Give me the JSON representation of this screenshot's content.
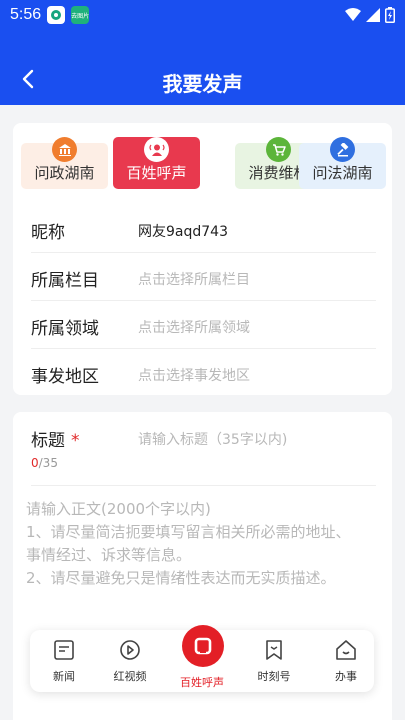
{
  "status_bar": {
    "time": "5:56",
    "app_badge": "去图片",
    "icons": [
      "wifi-icon",
      "signal-icon",
      "battery-icon"
    ]
  },
  "header": {
    "title": "我要发声",
    "back_icon": "chevron-left-icon",
    "background": "#1a4ff0"
  },
  "categories": [
    {
      "label": "问政湖南",
      "icon": "government-building-icon",
      "selected": false
    },
    {
      "label": "百姓呼声",
      "icon": "speaking-person-icon",
      "selected": true
    },
    {
      "label": "消费维权",
      "icon": "shopping-cart-icon",
      "selected": false
    },
    {
      "label": "问法湖南",
      "icon": "gavel-icon",
      "selected": false
    }
  ],
  "form": {
    "nickname": {
      "label": "昵称",
      "value": "网友9aqd743"
    },
    "column": {
      "label": "所属栏目",
      "placeholder": "点击选择所属栏目"
    },
    "field": {
      "label": "所属领域",
      "placeholder": "点击选择所属领域"
    },
    "region": {
      "label": "事发地区",
      "placeholder": "点击选择事发地区"
    }
  },
  "post": {
    "title_label": "标题",
    "required_mark": "*",
    "title_placeholder": "请输入标题（35字以内)",
    "counter_current": "0",
    "counter_max": "/35",
    "body_placeholder_line1": "请输入正文(2000个字以内)",
    "body_placeholder_line2": "1、请尽量简洁扼要填写留言相关所必需的地址、",
    "body_placeholder_line3": "事情经过、诉求等信息。",
    "body_placeholder_line4": "2、请尽量避免只是情绪性表达而无实质描述。"
  },
  "bottom_nav": [
    {
      "label": "新闻",
      "icon": "news-icon"
    },
    {
      "label": "红视频",
      "icon": "video-play-icon"
    },
    {
      "label": "百姓呼声",
      "icon": "voice-square-icon",
      "active": true
    },
    {
      "label": "时刻号",
      "icon": "bookmark-icon"
    },
    {
      "label": "办事",
      "icon": "house-icon"
    }
  ],
  "colors": {
    "accent_blue": "#1a4ff0",
    "accent_red": "#e31f26"
  }
}
